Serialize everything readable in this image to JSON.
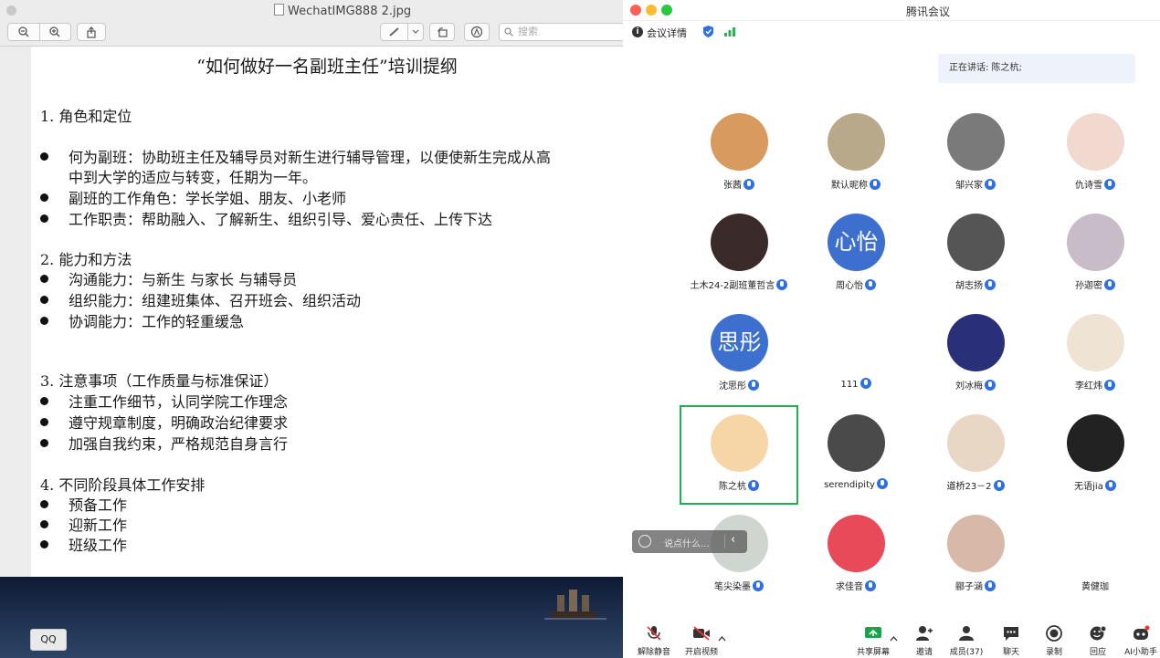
{
  "preview": {
    "window_title": "WechatIMG888 2.jpg",
    "search_placeholder": "搜索",
    "document": {
      "title": "“如何做好一名副班主任”培训提纲",
      "sections": [
        {
          "heading": "1.  角色和定位",
          "bullets": [
            "何为副班：协助班主任及辅导员对新生进行辅导管理，以便使新生完成从高",
            "副班的工作角色：学长学姐、朋友、小老师",
            "工作职责：帮助融入、了解新生、组织引导、爱心责任、上传下达"
          ],
          "continuation": "中到大学的适应与转变，任期为一年。"
        },
        {
          "heading": "2.  能力和方法",
          "bullets": [
            "沟通能力：与新生  与家长  与辅导员",
            "组织能力：组建班集体、召开班会、组织活动",
            "协调能力：工作的轻重缓急"
          ]
        },
        {
          "heading": "3.  注意事项（工作质量与标准保证）",
          "bullets": [
            "注重工作细节，认同学院工作理念",
            "遵守规章制度，明确政治纪律要求",
            "加强自我约束，严格规范自身言行"
          ]
        },
        {
          "heading": "4.  不同阶段具体工作安排",
          "bullets": [
            "预备工作",
            "迎新工作",
            "班级工作"
          ]
        }
      ]
    }
  },
  "meeting": {
    "window_title": "腾讯会议",
    "info_label": "会议详情",
    "speaking_text": "正在讲话: 陈之杭;",
    "participants": [
      {
        "name": "张茜",
        "avatar": "cat-photo",
        "color": "#d89a5e"
      },
      {
        "name": "默认昵称",
        "avatar": "sketch-photo",
        "color": "#b8a98a"
      },
      {
        "name": "邹兴家",
        "avatar": "bw-photo",
        "color": "#7a7a7a"
      },
      {
        "name": "仇诗雪",
        "avatar": "anime-girl",
        "color": "#f2d9cf"
      },
      {
        "name": "土木24-2副班董哲言",
        "avatar": "anime-character",
        "color": "#3b2a2a"
      },
      {
        "name": "周心怡",
        "avatar_text": "心怡",
        "color": "#3d6fcf"
      },
      {
        "name": "胡志扬",
        "avatar": "bw-portrait",
        "color": "#555555"
      },
      {
        "name": "孙迦密",
        "avatar": "cartoon-face",
        "color": "#c7bcc8"
      },
      {
        "name": "沈思彤",
        "avatar_text": "思彤",
        "color": "#3d6fcf"
      },
      {
        "name": "111",
        "avatar": "ghost-drawing",
        "color": "#ffffff"
      },
      {
        "name": "刘冰梅",
        "avatar": "night-photo",
        "color": "#2a2f7a"
      },
      {
        "name": "李红炜",
        "avatar": "anime-boy",
        "color": "#efe3d4"
      },
      {
        "name": "陈之杭",
        "avatar": "crayon-shin",
        "color": "#f6d6a6"
      },
      {
        "name": "serendipity",
        "avatar": "text-sign",
        "color": "#4a4a4a"
      },
      {
        "name": "道桥23－2",
        "avatar": "baby-photo",
        "color": "#e9d7c6"
      },
      {
        "name": "无语jia",
        "avatar": "hand-photo",
        "color": "#222222"
      },
      {
        "name": "笔尖染墨",
        "avatar": "sketch-man",
        "color": "#cfd6cf"
      },
      {
        "name": "求佳音",
        "avatar": "pink-plush",
        "color": "#e84a5a"
      },
      {
        "name": "郦子涵",
        "avatar": "girl-photo",
        "color": "#d8b8a8"
      },
      {
        "name": "黄健珈",
        "avatar": "none",
        "color": "#ffffff"
      }
    ],
    "chat_placeholder": "说点什么...",
    "bottom_bar": {
      "unmute": "解除静音",
      "video": "开启视频",
      "share": "共享屏幕",
      "invite": "邀请",
      "members": "成员(37)",
      "chat": "聊天",
      "record": "录制",
      "replay": "回应",
      "ai": "AI小助手"
    },
    "tooltip": "QQ"
  }
}
